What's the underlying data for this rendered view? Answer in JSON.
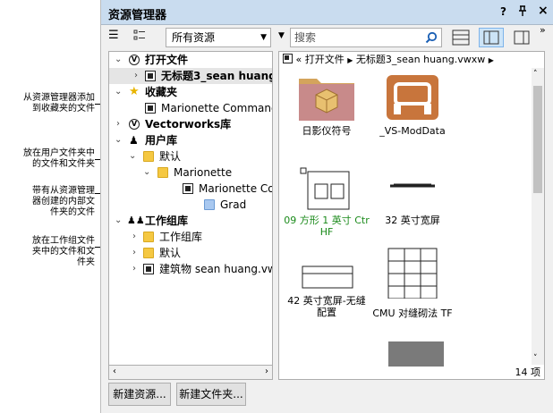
{
  "callouts": [
    "从资源管理器添加\n到收藏夹的文件",
    "放在用户文件夹中\n的文件和文件夹",
    "带有从资源管理\n器创建的内部文\n件夹的文件",
    "放在工作组文件\n夹中的文件和文\n件夹"
  ],
  "window": {
    "title": "资源管理器",
    "help": "?",
    "pin": "ᵖ",
    "close": "×"
  },
  "toolbar": {
    "filter_value": "所有资源",
    "search_placeholder": "搜索",
    "more": "»"
  },
  "tree": {
    "open_files": "打开文件",
    "open_file_item": "无标题3_sean huang.vw",
    "favorites": "收藏夹",
    "favorite_item": "Marionette Command Lib",
    "vw_library": "Vectorworks库",
    "user_library": "用户库",
    "default_folder": "默认",
    "marionette_folder": "Marionette",
    "marionette_file": "Marionette Comm",
    "grad_folder": "Grad",
    "workgroup_library": "工作组库",
    "wg_folder": "工作组库",
    "wg_default": "默认",
    "wg_file": "建筑物 sean huang.vwxw"
  },
  "content": {
    "path_prefix": "«",
    "path_parts": [
      "打开文件",
      "无标题3_sean huang.vwxw"
    ],
    "items": [
      {
        "label": "日影仪符号",
        "color": "#000000"
      },
      {
        "label": "_VS-ModData",
        "color": "#000000"
      },
      {
        "label": "09 方形 1 英寸 Ctr\nHF",
        "color": "#1a8a1a"
      },
      {
        "label": "32 英寸宽屏",
        "color": "#000000"
      },
      {
        "label": "42 英寸宽屏-无缝\n配置",
        "color": "#000000"
      },
      {
        "label": "CMU 对缝砌法 TF",
        "color": "#000000"
      }
    ],
    "count": "14 项"
  },
  "buttons": {
    "new_resource": "新建资源...",
    "new_folder": "新建文件夹..."
  },
  "colors": {
    "title_bar": "#c9dcef",
    "green_label": "#1a8a1a",
    "folder": "#f5c842"
  }
}
